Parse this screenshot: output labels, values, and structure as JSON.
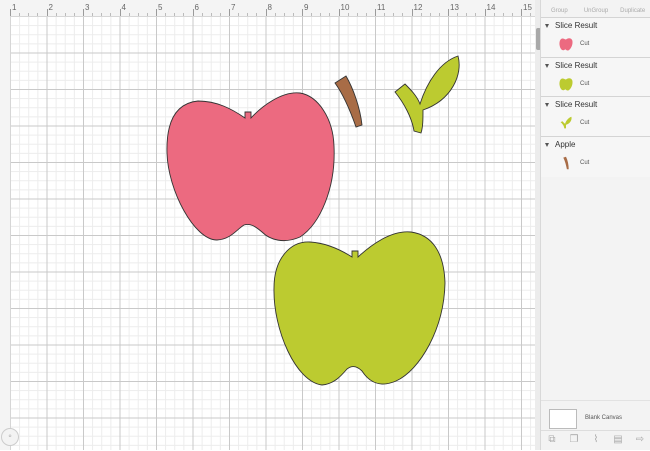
{
  "ruler": {
    "numbers": [
      "1",
      "2",
      "3",
      "4",
      "5",
      "6",
      "7",
      "8",
      "9",
      "10",
      "11",
      "12",
      "13",
      "14",
      "15"
    ]
  },
  "top_tools": [
    {
      "label": "Group",
      "icon": "group-icon"
    },
    {
      "label": "UnGroup",
      "icon": "ungroup-icon"
    },
    {
      "label": "Duplicate",
      "icon": "duplicate-icon"
    }
  ],
  "layers": [
    {
      "name": "Slice Result",
      "op": "Cut",
      "color": "#EC6A80",
      "shape": "apple"
    },
    {
      "name": "Slice Result",
      "op": "Cut",
      "color": "#BCCB30",
      "shape": "apple"
    },
    {
      "name": "Slice Result",
      "op": "Cut",
      "color": "#BCCB30",
      "shape": "leaf"
    },
    {
      "name": "Apple",
      "op": "Cut",
      "color": "#A86C46",
      "shape": "stem"
    }
  ],
  "blank_canvas": {
    "label": "Blank Canvas"
  },
  "bottom_tools": [
    "slice-icon",
    "combine-icon",
    "attach-icon",
    "flatten-icon",
    "contour-icon"
  ],
  "colors": {
    "pink": "#EC6A80",
    "green": "#BCCB30",
    "brown": "#A86C46",
    "outline": "#333333"
  }
}
